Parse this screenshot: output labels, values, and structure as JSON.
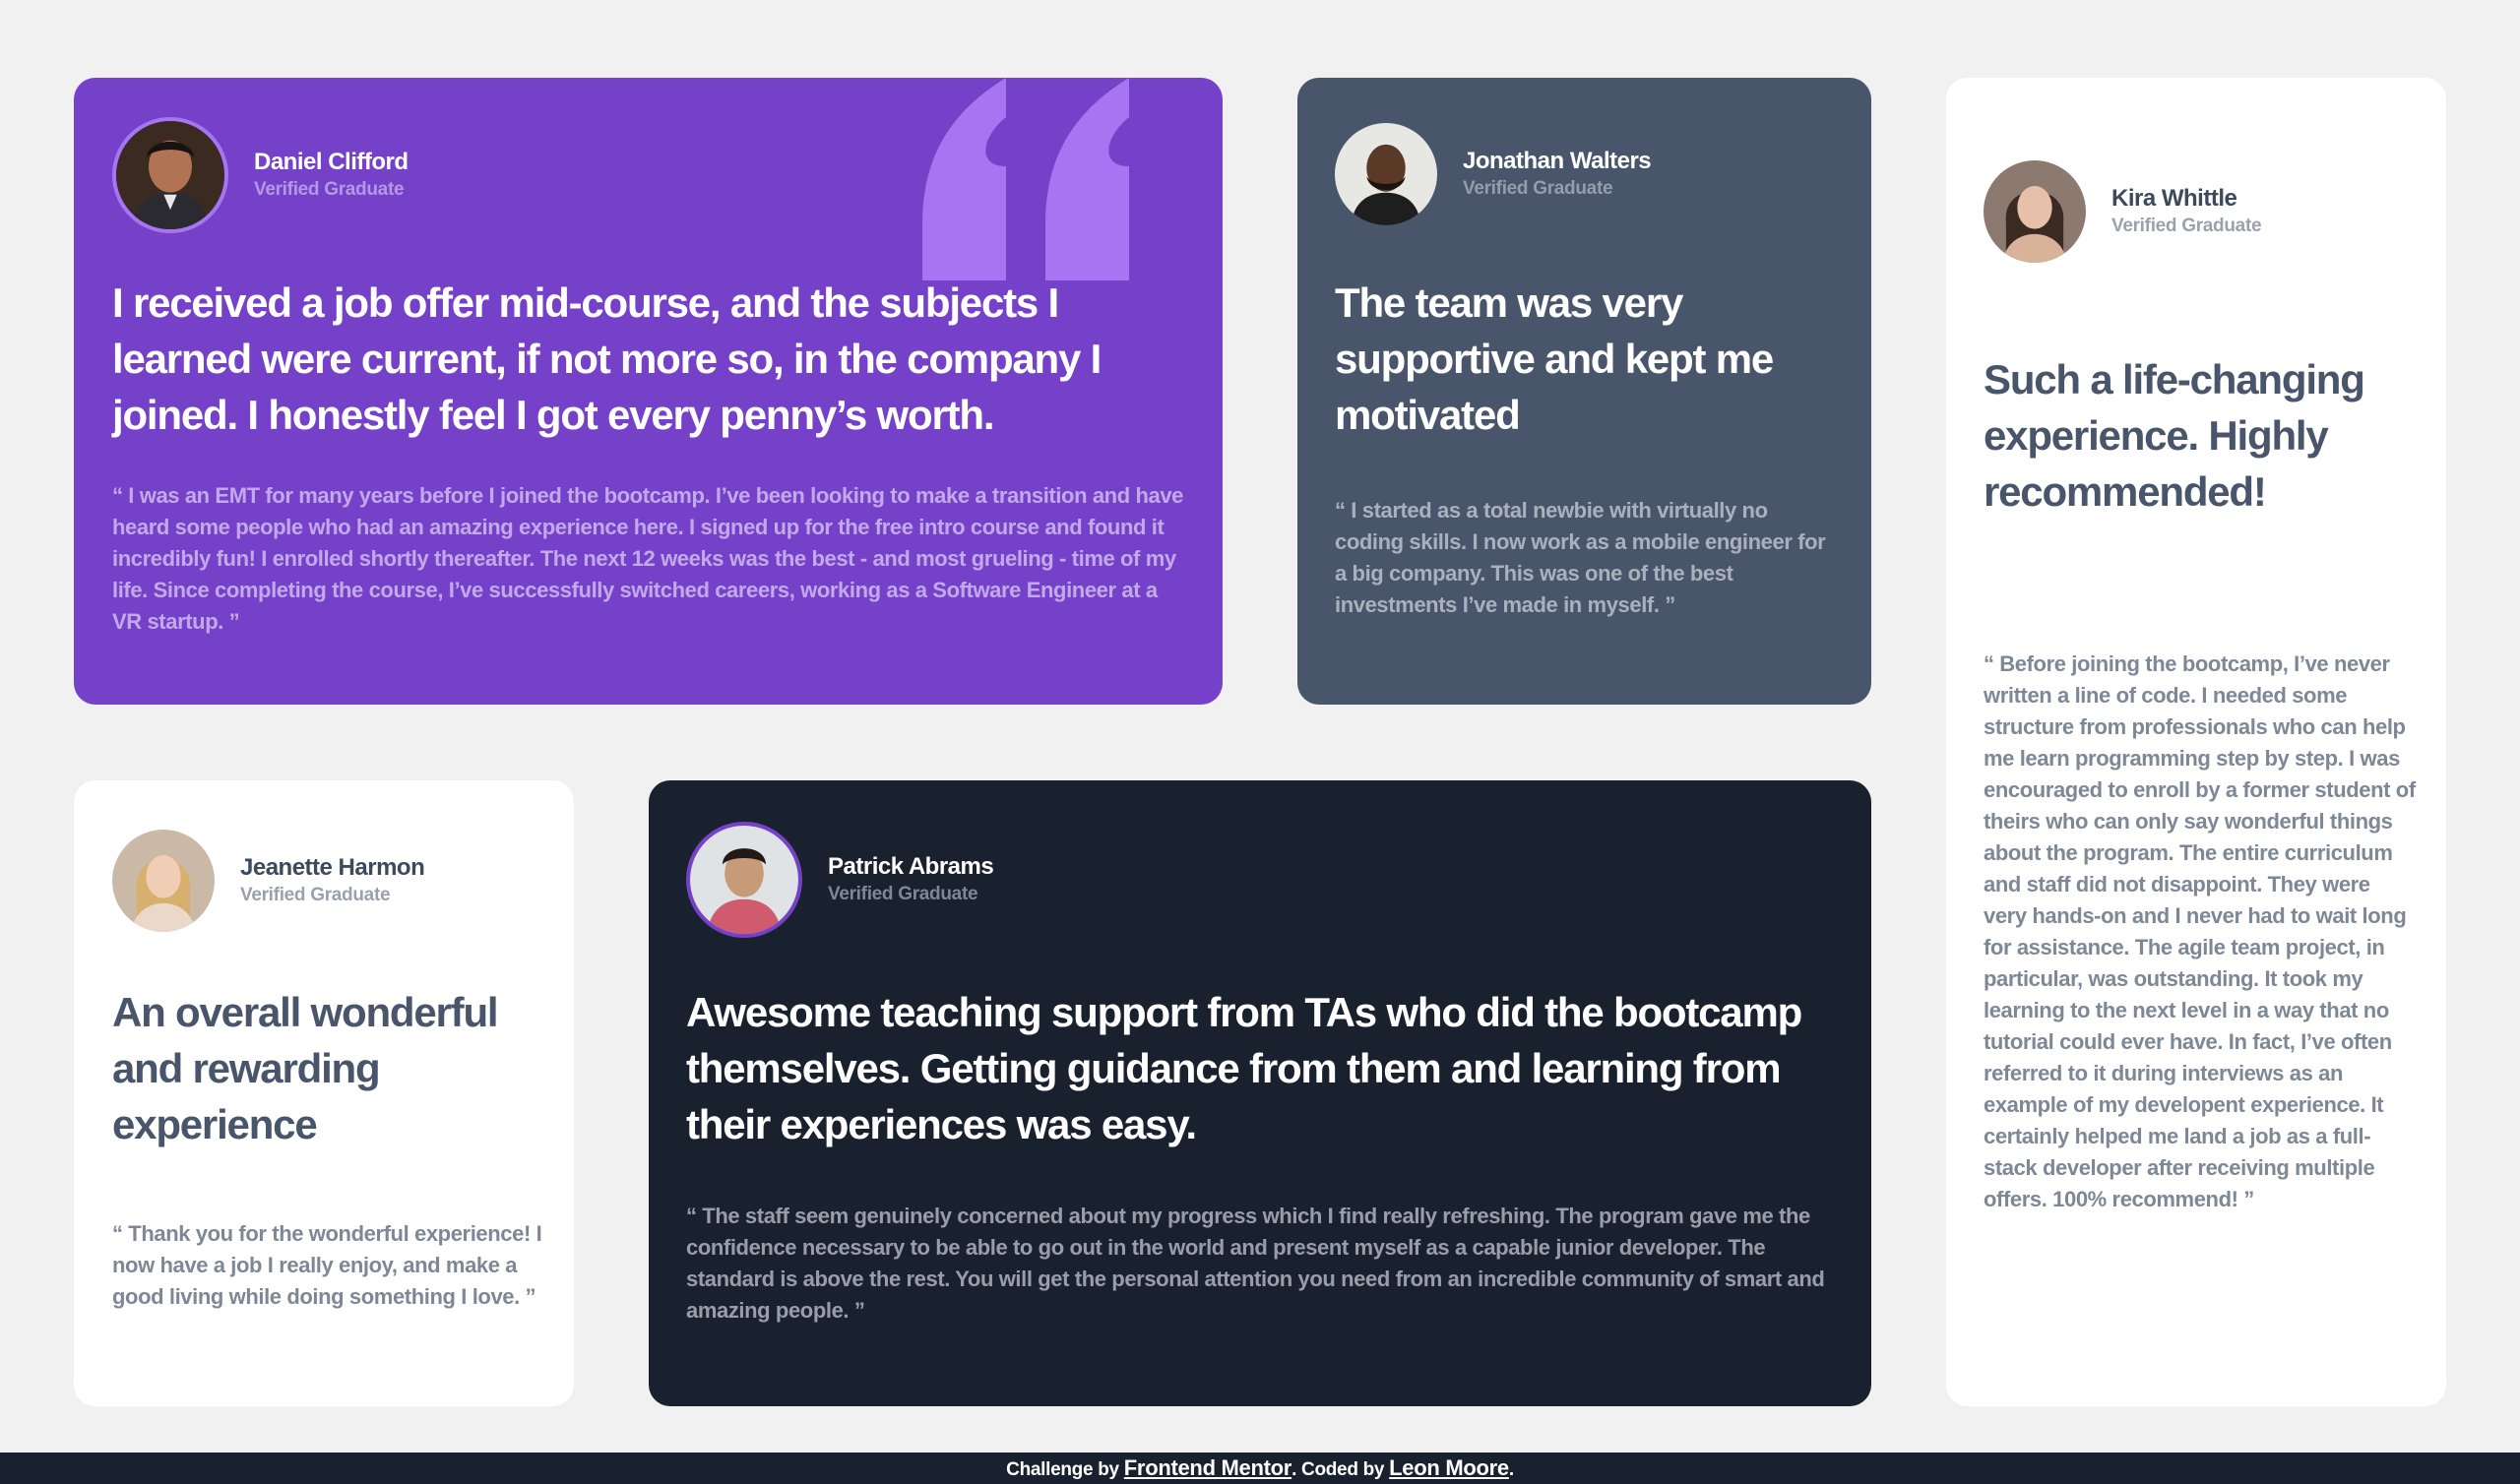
{
  "colors": {
    "page_bg": "#f2f1f2",
    "purple": "#7541c8",
    "gray_blue": "#48556a",
    "very_dark": "#19212e",
    "white": "#ffffff",
    "quote_mark": "#a775f1"
  },
  "testimonials": [
    {
      "name": "Daniel Clifford",
      "role": "Verified Graduate",
      "headline": "I received a job offer mid-course, and the subjects I learned were current, if not more so, in the company I joined. I honestly feel I got every penny’s worth.",
      "body": "“ I was an EMT for many years before I joined the bootcamp. I’ve been looking to make a transition and have heard some people who had an amazing experience here. I signed up for the free intro course and found it incredibly fun! I enrolled shortly thereafter. The next 12 weeks was the best - and most grueling - time of my life. Since completing the course, I’ve successfully switched careers, working as a Software Engineer at a VR startup. ”",
      "avatar_icon": "avatar-daniel"
    },
    {
      "name": "Jonathan Walters",
      "role": "Verified Graduate",
      "headline": "The team was very supportive and kept me motivated",
      "body": "“ I started as a total newbie with virtually no coding skills. I now work as a mobile engineer for a big company. This was one of the best investments I’ve made in myself. ”",
      "avatar_icon": "avatar-jonathan"
    },
    {
      "name": "Kira Whittle",
      "role": "Verified Graduate",
      "headline": "Such a life-changing experience. Highly recommended!",
      "body": "“ Before joining the bootcamp, I’ve never written a line of code. I needed some structure from professionals who can help me learn programming step by step. I was encouraged to enroll by a former student of theirs who can only say wonderful things about the program. The entire curriculum and staff did not disappoint. They were very hands-on and I never had to wait long for assistance. The agile team project, in particular, was outstanding. It took my learning to the next level in a way that no tutorial could ever have. In fact, I’ve often referred to it during interviews as an example of my developent experience. It certainly helped me land a job as a full-stack developer after receiving multiple offers. 100% recommend! ”",
      "avatar_icon": "avatar-kira"
    },
    {
      "name": "Jeanette Harmon",
      "role": "Verified Graduate",
      "headline": "An overall wonderful and rewarding experience",
      "body": "“ Thank you for the wonderful experience! I now have a job I really enjoy, and make a good living while doing something I love. ”",
      "avatar_icon": "avatar-jeanette"
    },
    {
      "name": "Patrick Abrams",
      "role": "Verified Graduate",
      "headline": "Awesome teaching support from TAs who did the bootcamp themselves. Getting guidance from them and learning from their experiences was easy.",
      "body": "“ The staff seem genuinely concerned about my progress which I find really refreshing. The program gave me the confidence necessary to be able to go out in the world and present myself as a capable junior developer. The standard is above the rest. You will get the personal attention you need from an incredible community of smart and amazing people. ”",
      "avatar_icon": "avatar-patrick"
    }
  ],
  "footer": {
    "prefix": "Challenge by ",
    "link1": "Frontend Mentor",
    "middle": ". Coded by ",
    "link2": "Leon Moore",
    "suffix": "."
  }
}
